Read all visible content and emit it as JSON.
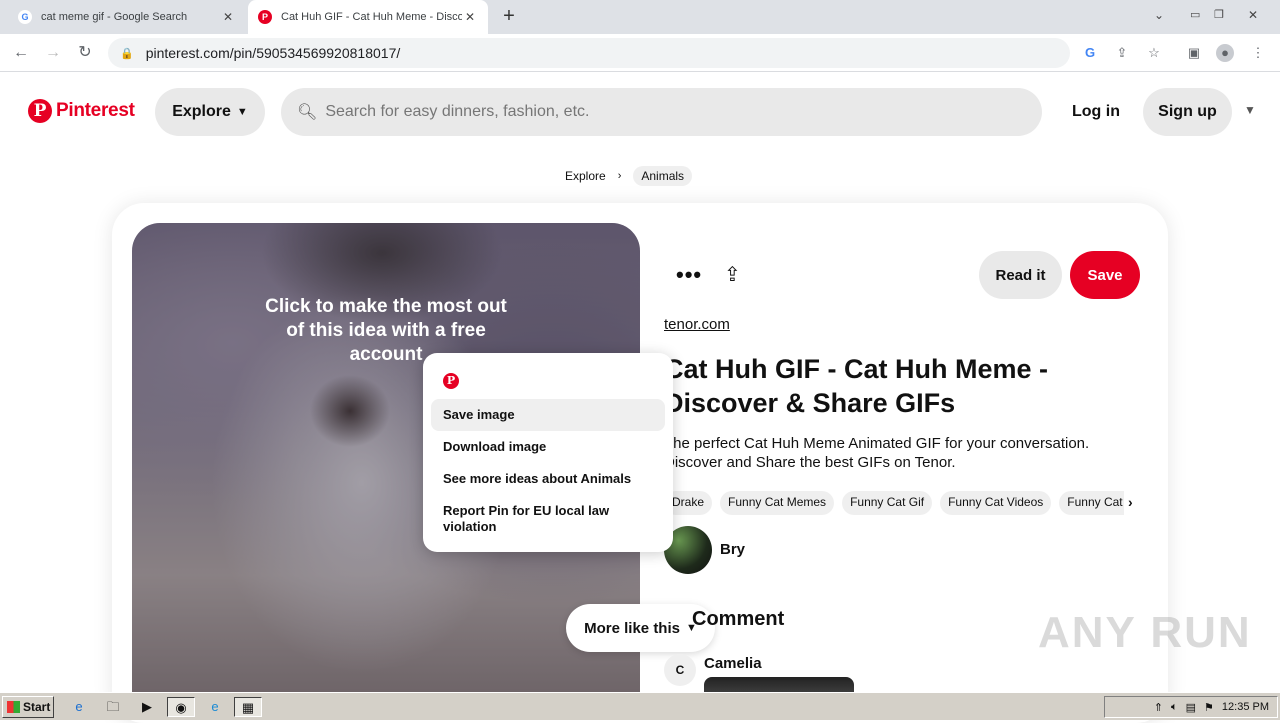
{
  "browser": {
    "tabs": [
      {
        "title": "cat meme gif - Google Search",
        "favicon": "G"
      },
      {
        "title": "Cat Huh GIF - Cat Huh Meme - Disco",
        "favicon": "P"
      }
    ],
    "url": "pinterest.com/pin/590534569920818017/"
  },
  "header": {
    "logo_text": "Pinterest",
    "explore_label": "Explore",
    "search_placeholder": "Search for easy dinners, fashion, etc.",
    "login_label": "Log in",
    "signup_label": "Sign up"
  },
  "breadcrumb": {
    "items": [
      "Explore",
      "Animals"
    ]
  },
  "pin": {
    "overlay_text": "Click to make the most out of this idea with a free account",
    "more_like_this": "More like this",
    "read_it_label": "Read it",
    "save_label": "Save",
    "source": "tenor.com",
    "title": "Cat Huh GIF - Cat Huh Meme - Discover & Share GIFs",
    "description": "The perfect Cat Huh Meme Animated GIF for your conversation. Discover and Share the best GIFs on Tenor.",
    "tags": [
      "Drake",
      "Funny Cat Memes",
      "Funny Cat Gif",
      "Funny Cat Videos",
      "Funny Cat F"
    ],
    "author": "Bry",
    "comment_heading": "Comment",
    "commenter_initial": "C",
    "commenter_name": "Camelia"
  },
  "context_menu": {
    "items": [
      "Save image",
      "Download image",
      "See more ideas about Animals",
      "Report Pin for EU local law violation"
    ]
  },
  "watermark": "ANY RUN",
  "taskbar": {
    "start_label": "Start",
    "clock": "12:35 PM"
  },
  "colors": {
    "brand": "#e60023",
    "chip_bg": "#e9e9e9"
  }
}
